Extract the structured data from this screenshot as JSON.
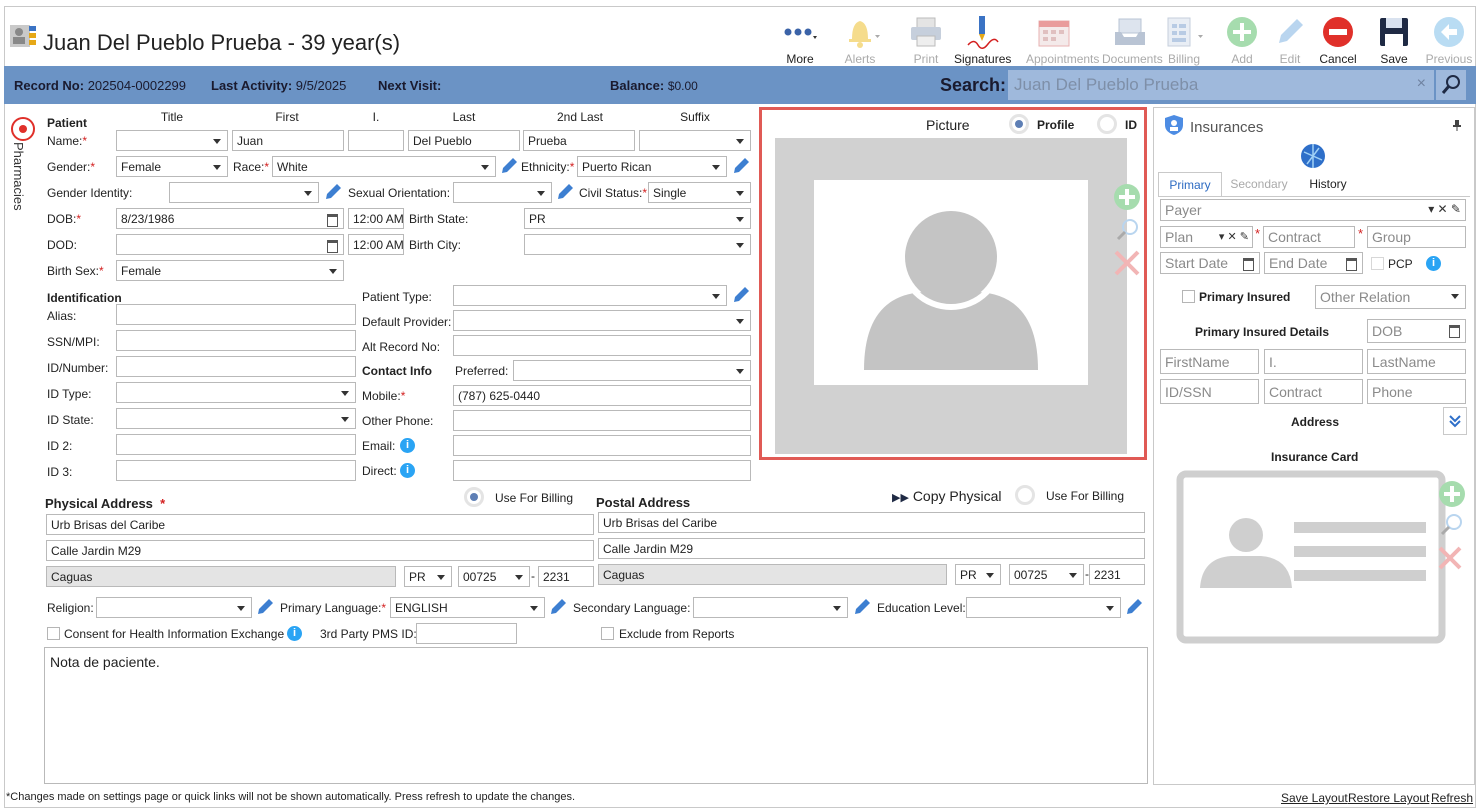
{
  "title": "Juan Del Pueblo Prueba - 39 year(s)",
  "toolbar": {
    "more": "More",
    "alerts": "Alerts",
    "print": "Print",
    "signatures": "Signatures",
    "appointments": "Appointments",
    "documents": "Documents",
    "billing": "Billing",
    "add": "Add",
    "edit": "Edit",
    "cancel": "Cancel",
    "save": "Save",
    "previous": "Previous"
  },
  "info": {
    "record_label": "Record No:",
    "record": "202504-0002299",
    "activity_label": "Last Activity:",
    "activity": "9/5/2025",
    "next_label": "Next Visit:",
    "next": "",
    "balance_label": "Balance:",
    "balance": "$0.00",
    "search_label": "Search:",
    "search_value": "Juan Del Pueblo Prueba",
    "clear": "×"
  },
  "sidebar": {
    "label": "Pharmacies"
  },
  "patient": {
    "section": "Patient",
    "headers": {
      "title": "Title",
      "first": "First",
      "mi": "I.",
      "last": "Last",
      "second_last": "2nd Last",
      "suffix": "Suffix"
    },
    "name_label": "Name:",
    "title": "",
    "first": "Juan",
    "mi": "",
    "last": "Del Pueblo",
    "second_last": "Prueba",
    "suffix": "",
    "gender_label": "Gender:",
    "gender": "Female",
    "race_label": "Race:",
    "race": "White",
    "ethnicity_label": "Ethnicity:",
    "ethnicity": "Puerto Rican",
    "gender_identity_label": "Gender Identity:",
    "gender_identity": "",
    "sexual_orientation_label": "Sexual Orientation:",
    "sexual_orientation": "",
    "civil_status_label": "Civil Status:",
    "civil_status": "Single",
    "dob_label": "DOB:",
    "dob": "8/23/1986",
    "dob_time": "12:00 AM",
    "birth_state_label": "Birth State:",
    "birth_state": "PR",
    "dod_label": "DOD:",
    "dod": "",
    "dod_time": "12:00 AM",
    "birth_city_label": "Birth City:",
    "birth_city": "",
    "birth_sex_label": "Birth Sex:",
    "birth_sex": "Female"
  },
  "identification": {
    "section": "Identification",
    "alias_label": "Alias:",
    "ssn_label": "SSN/MPI:",
    "idnum_label": "ID/Number:",
    "idtype_label": "ID Type:",
    "idstate_label": "ID State:",
    "id2_label": "ID 2:",
    "id3_label": "ID 3:"
  },
  "contact": {
    "patient_type_label": "Patient Type:",
    "default_provider_label": "Default Provider:",
    "alt_record_label": "Alt Record No:",
    "section": "Contact Info",
    "preferred_label": "Preferred:",
    "mobile_label": "Mobile:",
    "mobile": "(787) 625-0440",
    "other_phone_label": "Other Phone:",
    "email_label": "Email:",
    "direct_label": "Direct:"
  },
  "physical": {
    "section": "Physical Address",
    "use_billing": "Use For Billing",
    "line1": "Urb Brisas del Caribe",
    "line2": "Calle Jardin M29",
    "city": "Caguas",
    "state": "PR",
    "zip": "00725",
    "zip4": "2231"
  },
  "postal": {
    "section": "Postal Address",
    "copy": "Copy Physical",
    "use_billing": "Use For Billing",
    "line1": "Urb Brisas del Caribe",
    "line2": "Calle Jardin M29",
    "city": "Caguas",
    "state": "PR",
    "zip": "00725",
    "zip4": "2231"
  },
  "misc": {
    "religion_label": "Religion:",
    "primary_language_label": "Primary Language:",
    "primary_language": "ENGLISH",
    "secondary_language_label": "Secondary Language:",
    "education_label": "Education Level:",
    "consent_label": "Consent for Health Information Exchange",
    "pms_label": "3rd Party PMS ID:",
    "exclude_label": "Exclude from Reports"
  },
  "notes": "Nota de paciente.",
  "picture": {
    "label": "Picture",
    "profile": "Profile",
    "id": "ID"
  },
  "insurance": {
    "title": "Insurances",
    "tabs": [
      "Primary",
      "Secondary",
      "History"
    ],
    "payer": "Payer",
    "plan": "Plan",
    "contract": "Contract",
    "group": "Group",
    "start_date": "Start Date",
    "end_date": "End Date",
    "pcp": "PCP",
    "primary_insured": "Primary Insured",
    "other_relation": "Other Relation",
    "details": "Primary Insured Details",
    "dob": "DOB",
    "firstname": "FirstName",
    "mi": "I.",
    "lastname": "LastName",
    "idssn": "ID/SSN",
    "contract2": "Contract",
    "phone": "Phone",
    "address": "Address",
    "card": "Insurance Card"
  },
  "footer": {
    "note": "*Changes made on settings page or quick links will not be shown automatically. Press refresh to update the changes.",
    "save_layout": "Save Layout",
    "restore_layout": "Restore Layout",
    "refresh": "Refresh"
  },
  "colors": {
    "infobar": "#6b93c5",
    "highlight": "#e05a55",
    "accent": "#2aa4f4"
  }
}
